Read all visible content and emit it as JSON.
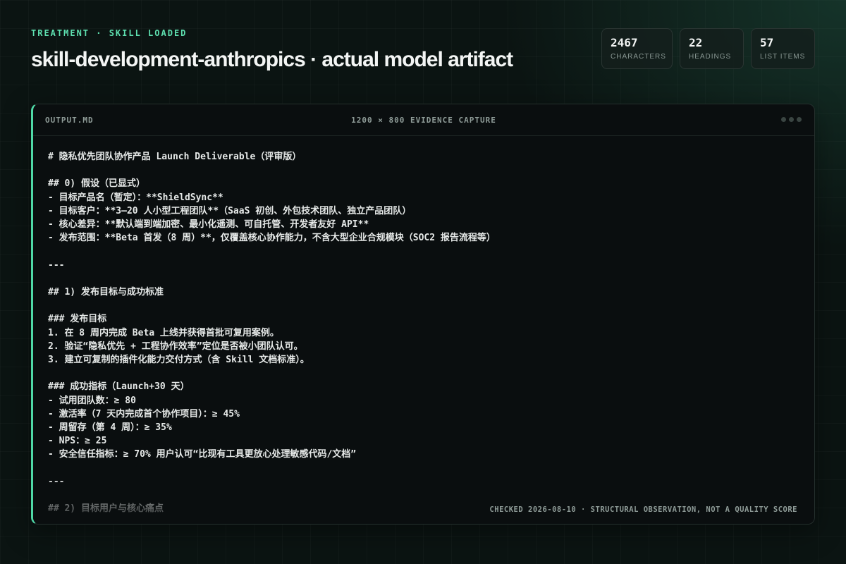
{
  "header": {
    "eyebrow": "TREATMENT · SKILL LOADED",
    "title": "skill-development-anthropics · actual model artifact"
  },
  "stats": [
    {
      "value": "2467",
      "label": "CHARACTERS"
    },
    {
      "value": "22",
      "label": "HEADINGS"
    },
    {
      "value": "57",
      "label": "LIST ITEMS"
    }
  ],
  "window": {
    "file_name": "OUTPUT.MD",
    "capture_label": "1200 × 800 EVIDENCE CAPTURE",
    "content": "# 隐私优先团队协作产品 Launch Deliverable（评审版）\n\n## 0) 假设（已显式）\n- 目标产品名（暂定）：**ShieldSync**\n- 目标客户：**3–20 人小型工程团队**（SaaS 初创、外包技术团队、独立产品团队）\n- 核心差异：**默认端到端加密、最小化遥测、可自托管、开发者友好 API**\n- 发布范围：**Beta 首发（8 周）**，仅覆盖核心协作能力，不含大型企业合规模块（SOC2 报告流程等）\n\n---\n\n## 1) 发布目标与成功标准\n\n### 发布目标\n1. 在 8 周内完成 Beta 上线并获得首批可复用案例。\n2. 验证“隐私优先 + 工程协作效率”定位是否被小团队认可。\n3. 建立可复制的插件化能力交付方式（含 Skill 文档标准）。\n\n### 成功指标（Launch+30 天）\n- 试用团队数：≥ 80\n- 激活率（7 天内完成首个协作项目）：≥ 45%\n- 周留存（第 4 周）：≥ 35%\n- NPS：≥ 25\n- 安全信任指标：≥ 70% 用户认可“比现有工具更放心处理敏感代码/文档”\n\n---\n\n## 2) 目标用户与核心痛点",
    "footer_note": "CHECKED 2026-08-10 · STRUCTURAL OBSERVATION, NOT A QUALITY SCORE"
  },
  "colors": {
    "accent": "#4fd8a6",
    "eyebrow": "#5ee0b0",
    "background": "#0b1412",
    "panel": "#0a0e0f"
  },
  "icons": [
    "window-dots-icon"
  ]
}
